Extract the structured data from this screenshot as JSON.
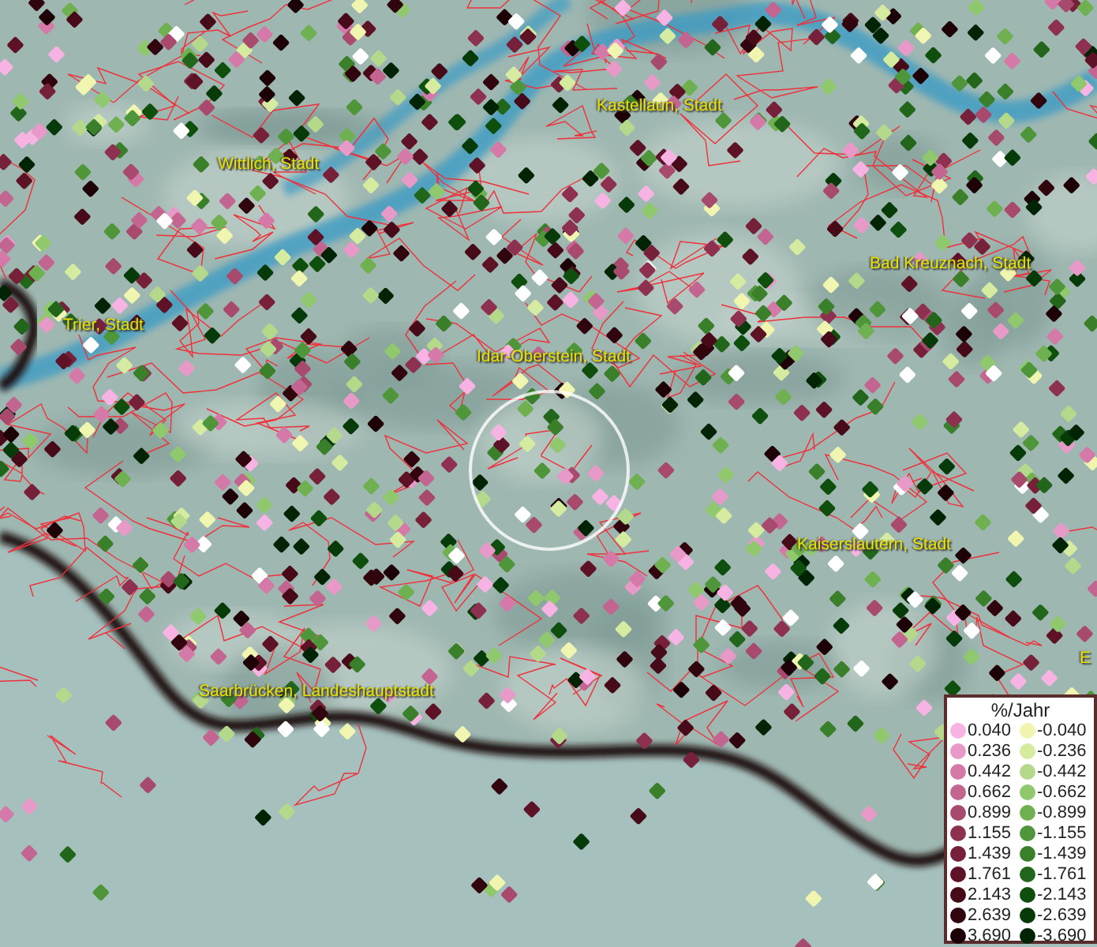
{
  "map": {
    "place_labels": [
      {
        "text": "Kastellaun, Stadt"
      },
      {
        "text": "Wittlich, Stadt"
      },
      {
        "text": "Bad Kreuznach, Stadt"
      },
      {
        "text": "Trier, Stadt"
      },
      {
        "text": "Idar-Oberstein, Stadt"
      },
      {
        "text": "Kaiserslautern, Stadt"
      },
      {
        "text": "Saarbrücken, Landeshauptstadt"
      },
      {
        "text": "E"
      }
    ]
  },
  "legend": {
    "title": "%/Jahr",
    "positive": [
      {
        "value": "0.040",
        "color": "#f7b3e3"
      },
      {
        "value": "0.236",
        "color": "#e79ac8"
      },
      {
        "value": "0.442",
        "color": "#d57aa8"
      },
      {
        "value": "0.662",
        "color": "#c26590"
      },
      {
        "value": "0.899",
        "color": "#a84a6e"
      },
      {
        "value": "1.155",
        "color": "#8e3050"
      },
      {
        "value": "1.439",
        "color": "#76203a"
      },
      {
        "value": "1.761",
        "color": "#5e1226"
      },
      {
        "value": "2.143",
        "color": "#460a18"
      },
      {
        "value": "2.639",
        "color": "#30050e"
      },
      {
        "value": "3.690",
        "color": "#1c0206"
      }
    ],
    "negative": [
      {
        "value": "-0.040",
        "color": "#f0f5b0"
      },
      {
        "value": "-0.236",
        "color": "#d5eba0"
      },
      {
        "value": "-0.442",
        "color": "#b5d98a"
      },
      {
        "value": "-0.662",
        "color": "#90c86e"
      },
      {
        "value": "-0.899",
        "color": "#6fb050"
      },
      {
        "value": "-1.155",
        "color": "#4f963a"
      },
      {
        "value": "-1.439",
        "color": "#3a7f2a"
      },
      {
        "value": "-1.761",
        "color": "#22661c"
      },
      {
        "value": "-2.143",
        "color": "#0f4f0e"
      },
      {
        "value": "-2.639",
        "color": "#063a08"
      },
      {
        "value": "-3.690",
        "color": "#022405"
      }
    ]
  }
}
